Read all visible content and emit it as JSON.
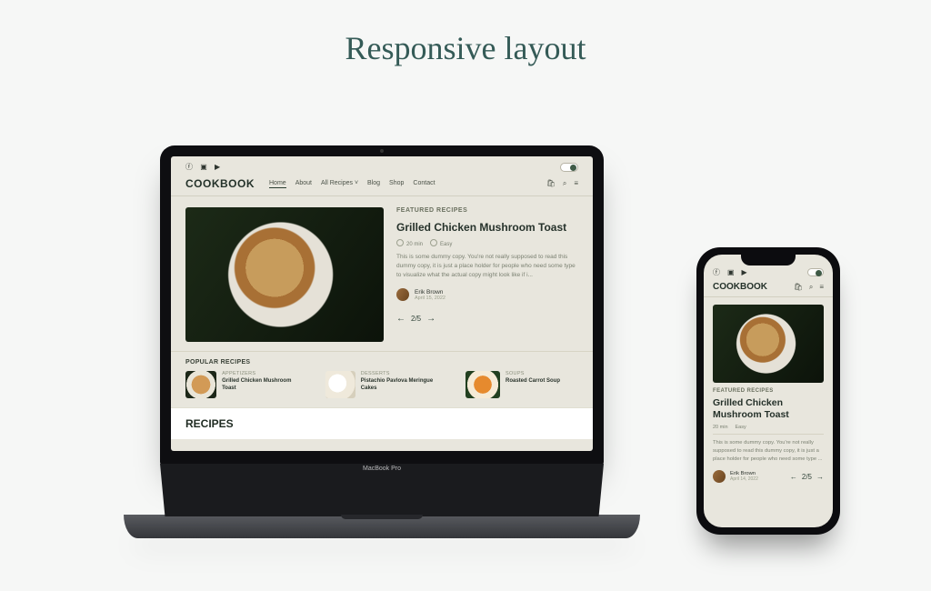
{
  "heading": "Responsive layout",
  "laptop": {
    "model": "MacBook Pro",
    "brand": "COOKBOOK",
    "nav": {
      "home": "Home",
      "about": "About",
      "recipes": "All Recipes ˅",
      "blog": "Blog",
      "shop": "Shop",
      "contact": "Contact"
    },
    "featured": {
      "kicker": "FEATURED RECIPES",
      "title": "Grilled Chicken Mushroom Toast",
      "time": "20 min",
      "difficulty": "Easy",
      "desc": "This is some dummy copy. You're not really supposed to read this dummy copy, it is just a place holder for people who need some type to visualize what the actual copy might look like if i...",
      "author": "Erik Brown",
      "date": "April 15, 2022",
      "pager": "2/5"
    },
    "popular": {
      "heading": "POPULAR RECIPES",
      "items": [
        {
          "cat": "APPETIZERS",
          "title": "Grilled Chicken Mushroom Toast"
        },
        {
          "cat": "DESSERTS",
          "title": "Pistachio Pavlova Meringue Cakes"
        },
        {
          "cat": "SOUPS",
          "title": "Roasted Carrot Soup"
        }
      ]
    },
    "section": "RECIPES"
  },
  "phone": {
    "brand": "COOKBOOK",
    "kicker": "FEATURED RECIPES",
    "title": "Grilled Chicken Mushroom Toast",
    "time": "20 min",
    "difficulty": "Easy",
    "desc": "This is some dummy copy. You're not really supposed to read this dummy copy, it is just a place holder for people who need some type ...",
    "author": "Erik Brown",
    "date": "April 14, 2022",
    "pager": "2/5"
  }
}
